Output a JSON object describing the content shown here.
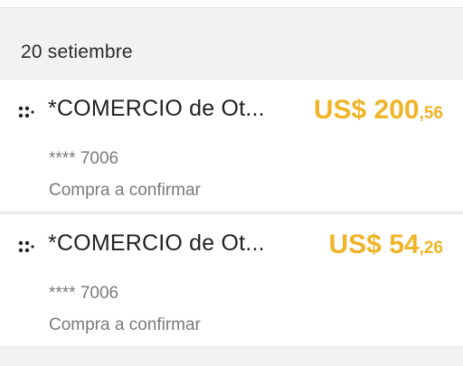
{
  "date_header": "20 setiembre",
  "transactions": [
    {
      "merchant": "*COMERCIO de Ot...",
      "amount_main": "US$ 200",
      "amount_cents": ",56",
      "card_number": "**** 7006",
      "status": "Compra a confirmar"
    },
    {
      "merchant": "*COMERCIO de Ot...",
      "amount_main": "US$ 54",
      "amount_cents": ",26",
      "card_number": "**** 7006",
      "status": "Compra a confirmar"
    }
  ],
  "colors": {
    "amount": "#f0b429",
    "background": "#f2f2f2",
    "card": "#ffffff"
  },
  "icons": {
    "merchant": "dots-merchant-icon"
  }
}
